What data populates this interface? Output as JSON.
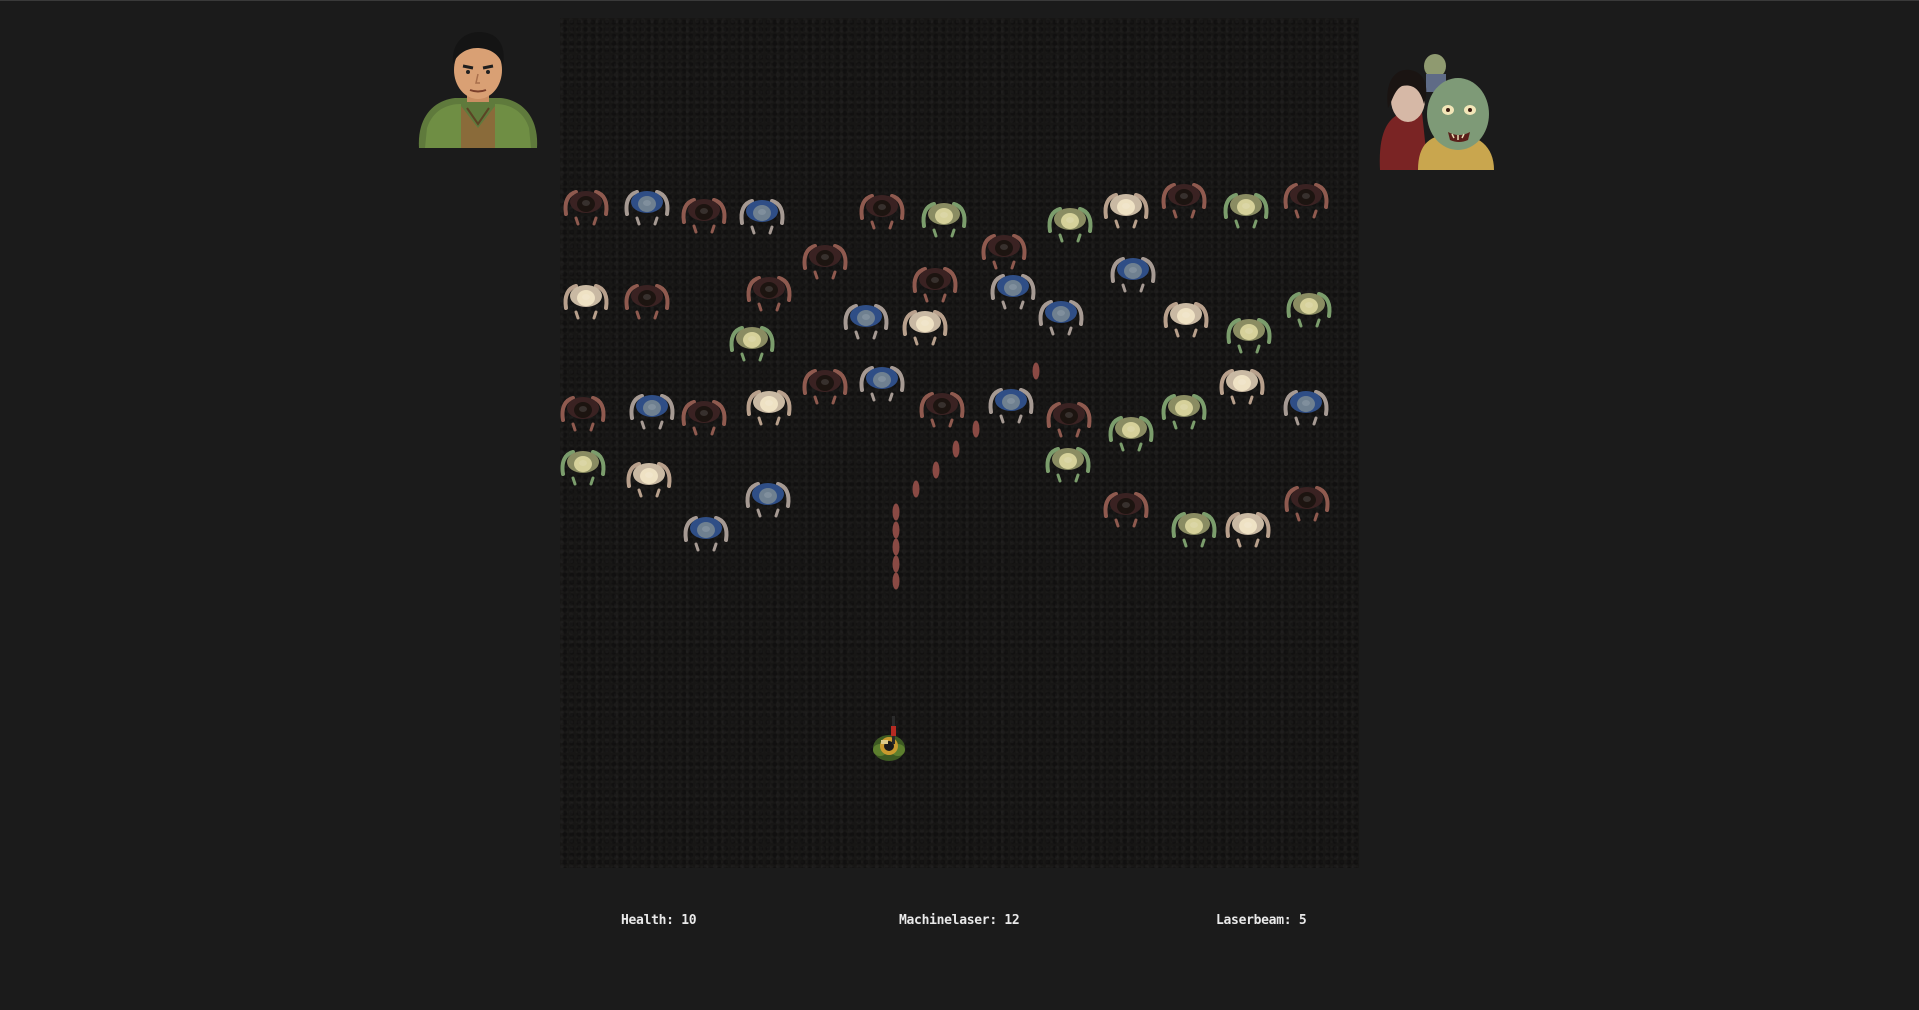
{
  "hud": {
    "health_label": "Health",
    "health_value": "10",
    "machinelaser_label": "Machinelaser",
    "machinelaser_value": "12",
    "laserbeam_label": "Laserbeam",
    "laserbeam_value": "5"
  },
  "portraits": {
    "hero_icon": "soldier-portrait-icon",
    "zombie_icon": "zombie-group-portrait-icon"
  },
  "colors": {
    "page_background": "#1b1b1b",
    "arena_background": "#171615",
    "hud_text": "#e9e9e9",
    "bullet": "#8a4a44"
  },
  "zombie_variants": {
    "dark": {
      "shirt": "#3a2222",
      "head": "#1c1410",
      "arm": "#8f5a4f"
    },
    "blue": {
      "shirt": "#2f4e86",
      "head": "#6f8090",
      "arm": "#a69a93"
    },
    "pale": {
      "shirt": "#c9b9a3",
      "head": "#efe2c4",
      "arm": "#b8a08c"
    },
    "green": {
      "shirt": "#8a8c62",
      "head": "#d6d19a",
      "arm": "#7b9d6c"
    }
  }
}
